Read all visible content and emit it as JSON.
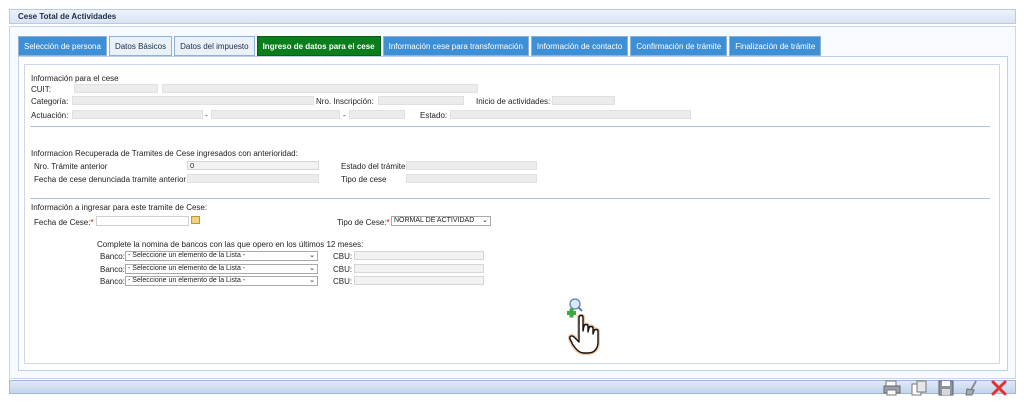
{
  "window": {
    "title": "Cese Total de Actividades"
  },
  "tabs": [
    {
      "label": "Selección de persona",
      "state": "normal"
    },
    {
      "label": "Datos Básicos",
      "state": "light"
    },
    {
      "label": "Datos del impuesto",
      "state": "light"
    },
    {
      "label": "Ingreso de datos para el cese",
      "state": "active"
    },
    {
      "label": "Información cese para transformación",
      "state": "normal"
    },
    {
      "label": "Información de contacto",
      "state": "normal"
    },
    {
      "label": "Confirmación de trámite",
      "state": "normal"
    },
    {
      "label": "Finalización de trámite",
      "state": "normal"
    }
  ],
  "cese_info": {
    "heading": "Información para el cese",
    "cuit_label": "CUIT:",
    "categoria_label": "Categoría:",
    "nro_inscripcion_label": "Nro. Inscripción:",
    "inicio_label": "Inicio de actividades:",
    "actuacion_label": "Actuación:",
    "dash": "-",
    "estado_label": "Estado:"
  },
  "recuperada": {
    "heading": "Informacion Recuperada de Tramites de Cese ingresados con anterioridad:",
    "nro_tramite_label": "Nro. Trámite anterior",
    "nro_tramite_value": "0",
    "estado_tramite_label": "Estado del trámite",
    "fecha_cese_label": "Fecha de cese denunciada tramite anterior",
    "tipo_cese_label": "Tipo de cese"
  },
  "ingresar": {
    "heading": "Información a ingresar para este tramite de Cese:",
    "fecha_cese_label": "Fecha de Cese:",
    "required_mark": "*",
    "tipo_cese_label": "Tipo de Cese:",
    "tipo_cese_value": "NORMAL DE ACTIVIDAD",
    "bancos_heading": "Complete la nomina de bancos con las que opero en los últimos 12 meses:",
    "banco_label": "Banco:",
    "cbu_label": "CBU:",
    "banco_placeholder": "- Seleccione un elemento de la Lista -"
  },
  "icons": {
    "add": "search-add-icon",
    "cursor": "hand-cursor-icon",
    "toolbar": [
      "print-icon",
      "copy-icon",
      "save-icon",
      "clean-icon",
      "close-icon"
    ]
  },
  "colors": {
    "active_tab": "#0a7d1c",
    "tab": "#3d8fd6",
    "close": "#e0342c"
  }
}
